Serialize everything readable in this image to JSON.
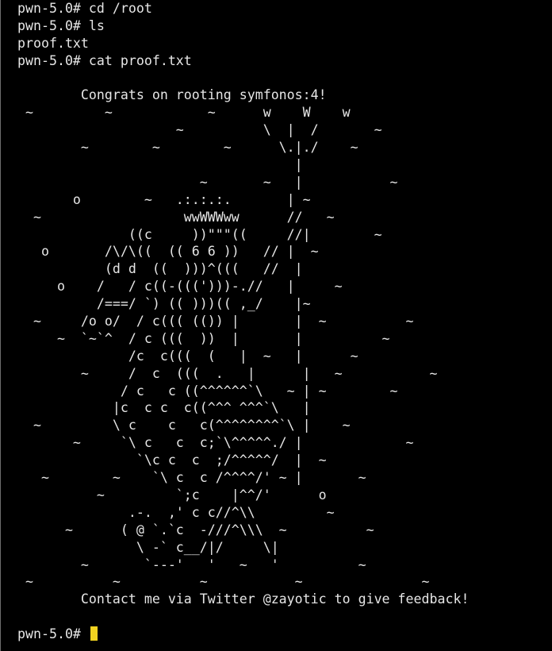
{
  "terminal": {
    "prompt": "pwn-5.0# ",
    "lines": [
      "pwn-5.0# cd /root",
      "pwn-5.0# ls",
      "proof.txt",
      "pwn-5.0# cat proof.txt",
      "",
      "        Congrats on rooting symfonos:4!",
      " ~         ~            ~      w    W    w",
      "                    ~          \\  |  /       ~",
      "        ~        ~        ~      \\.|./    ~",
      "                                   |",
      "                       ~       ~   |           ~",
      "       o        ~   .:.:.:.       | ~",
      "  ~                  wwWWWww      //   ~",
      "              ((c     ))\"\"\"((     //|        ~",
      "   o       /\\/\\((  (( 6 6 ))   // |  ~",
      "           (d d  ((  )))^(((   //  |",
      "     o    /   / c((-(((')))-.//   |     ~",
      "          /===/ `) (( )))(( ,_/    |~",
      "  ~     /o o/  / c((( (()) |       |  ~          ~",
      "     ~  `~`^  / c (((  ))  |       |          ~",
      "              /c  c(((  (   |  ~   |      ~",
      "        ~     /  c  (((  .   |      |   ~           ~",
      "             / c   c ((^^^^^^`\\   ~ | ~        ~",
      "            |c  c c  c((^^^ ^^^`\\   |",
      "  ~         \\ c    c   c(^^^^^^^^`\\ |    ~",
      "       ~     `\\ c   c  c;`\\^^^^^./ |             ~",
      "               `\\c c  c  ;/^^^^^/  |  ~",
      "   ~        ~    `\\ c  c /^^^^/' ~ |       ~",
      "          ~         `;c    |^^/'      o",
      "              .-.  ,' c c//^\\\\         ~",
      "      ~      ( @ `.`c  -///^\\\\\\  ~          ~",
      "               \\ -` c__/|/     \\|",
      "        ~       `---'   '   ~   '          ~",
      " ~          ~          ~           ~               ~",
      "        Contact me via Twitter @zayotic to give feedback!",
      "",
      "pwn-5.0# "
    ],
    "cursor_color": "#f2d320",
    "background_color": "#000000",
    "text_color": "#e6e6e6"
  }
}
